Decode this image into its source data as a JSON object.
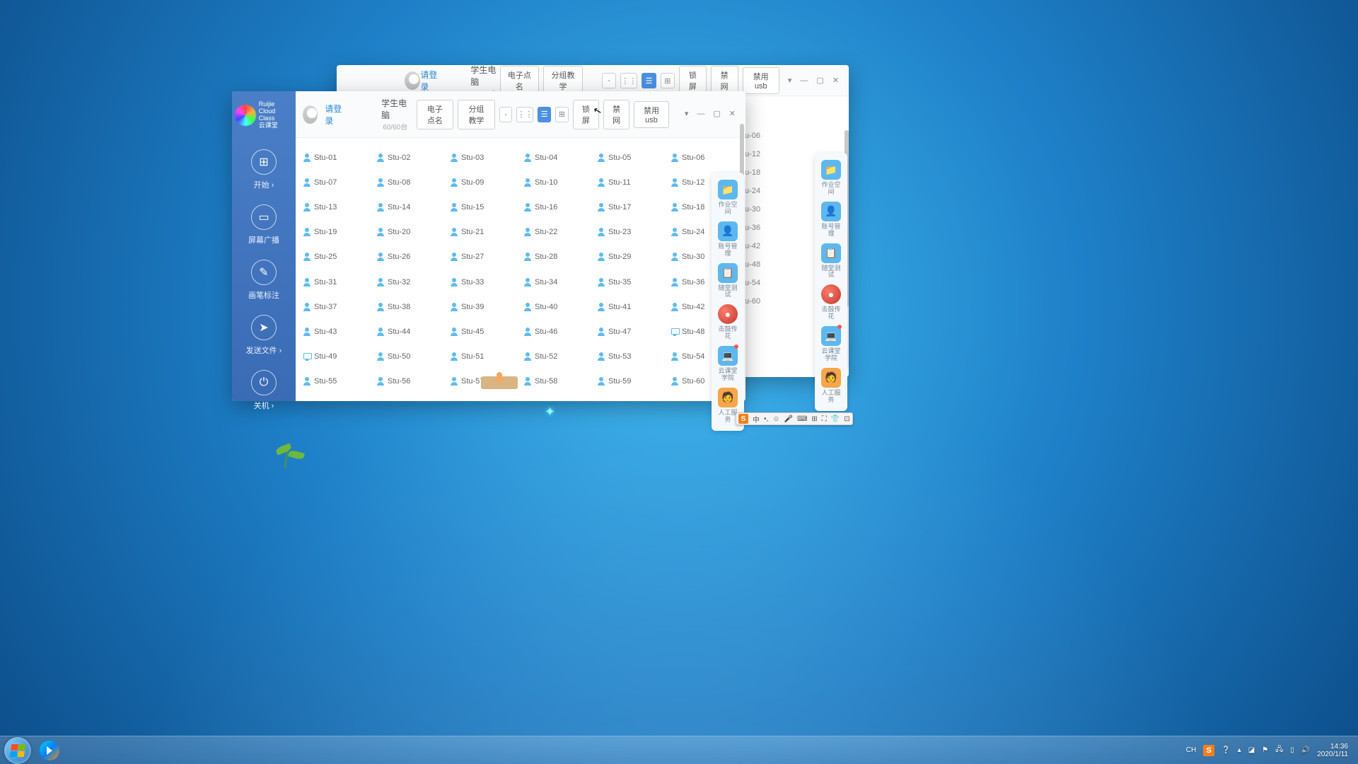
{
  "app": {
    "brand_top": "Ruijie",
    "brand_mid": "Cloud Class",
    "brand_cn": "云课堂"
  },
  "login_text": "请登录",
  "header": {
    "title": "学生电脑",
    "count": "60/60台"
  },
  "toolbar": {
    "roll_call": "电子点名",
    "group_teach": "分组教学",
    "lock_screen": "锁屏",
    "block_net": "禁网",
    "block_usb": "禁用usb",
    "minus": "-"
  },
  "sidebar": {
    "start": "开始 ›",
    "broadcast": "屏幕广播",
    "annotate": "画笔标注",
    "send_file": "发送文件 ›",
    "shutdown": "关机 ›"
  },
  "students": [
    {
      "n": "Stu-01",
      "t": "p"
    },
    {
      "n": "Stu-02",
      "t": "p"
    },
    {
      "n": "Stu-03",
      "t": "p"
    },
    {
      "n": "Stu-04",
      "t": "p"
    },
    {
      "n": "Stu-05",
      "t": "p"
    },
    {
      "n": "Stu-06",
      "t": "p"
    },
    {
      "n": "Stu-07",
      "t": "p"
    },
    {
      "n": "Stu-08",
      "t": "p"
    },
    {
      "n": "Stu-09",
      "t": "p"
    },
    {
      "n": "Stu-10",
      "t": "p"
    },
    {
      "n": "Stu-11",
      "t": "p"
    },
    {
      "n": "Stu-12",
      "t": "p"
    },
    {
      "n": "Stu-13",
      "t": "p"
    },
    {
      "n": "Stu-14",
      "t": "p"
    },
    {
      "n": "Stu-15",
      "t": "p"
    },
    {
      "n": "Stu-16",
      "t": "p"
    },
    {
      "n": "Stu-17",
      "t": "p"
    },
    {
      "n": "Stu-18",
      "t": "p"
    },
    {
      "n": "Stu-19",
      "t": "p"
    },
    {
      "n": "Stu-20",
      "t": "p"
    },
    {
      "n": "Stu-21",
      "t": "p"
    },
    {
      "n": "Stu-22",
      "t": "p"
    },
    {
      "n": "Stu-23",
      "t": "p"
    },
    {
      "n": "Stu-24",
      "t": "p"
    },
    {
      "n": "Stu-25",
      "t": "p"
    },
    {
      "n": "Stu-26",
      "t": "p"
    },
    {
      "n": "Stu-27",
      "t": "p"
    },
    {
      "n": "Stu-28",
      "t": "p"
    },
    {
      "n": "Stu-29",
      "t": "p"
    },
    {
      "n": "Stu-30",
      "t": "p"
    },
    {
      "n": "Stu-31",
      "t": "p"
    },
    {
      "n": "Stu-32",
      "t": "p"
    },
    {
      "n": "Stu-33",
      "t": "p"
    },
    {
      "n": "Stu-34",
      "t": "p"
    },
    {
      "n": "Stu-35",
      "t": "p"
    },
    {
      "n": "Stu-36",
      "t": "p"
    },
    {
      "n": "Stu-37",
      "t": "p"
    },
    {
      "n": "Stu-38",
      "t": "p"
    },
    {
      "n": "Stu-39",
      "t": "p"
    },
    {
      "n": "Stu-40",
      "t": "p"
    },
    {
      "n": "Stu-41",
      "t": "p"
    },
    {
      "n": "Stu-42",
      "t": "p"
    },
    {
      "n": "Stu-43",
      "t": "p"
    },
    {
      "n": "Stu-44",
      "t": "p"
    },
    {
      "n": "Stu-45",
      "t": "p"
    },
    {
      "n": "Stu-46",
      "t": "p"
    },
    {
      "n": "Stu-47",
      "t": "p"
    },
    {
      "n": "Stu-48",
      "t": "m"
    },
    {
      "n": "Stu-49",
      "t": "m"
    },
    {
      "n": "Stu-50",
      "t": "p"
    },
    {
      "n": "Stu-51",
      "t": "p"
    },
    {
      "n": "Stu-52",
      "t": "p"
    },
    {
      "n": "Stu-53",
      "t": "p"
    },
    {
      "n": "Stu-54",
      "t": "p"
    },
    {
      "n": "Stu-55",
      "t": "p"
    },
    {
      "n": "Stu-56",
      "t": "p"
    },
    {
      "n": "Stu-57",
      "t": "p"
    },
    {
      "n": "Stu-58",
      "t": "p"
    },
    {
      "n": "Stu-59",
      "t": "p"
    },
    {
      "n": "Stu-60",
      "t": "p"
    }
  ],
  "back_col": [
    "tu-06",
    "tu-12",
    "tu-18",
    "tu-24",
    "tu-30",
    "tu-36",
    "tu-42",
    "tu-48",
    "tu-54",
    "tu-60"
  ],
  "right_panel": {
    "homework": "作业空间",
    "account": "账号管理",
    "quiz": "随堂测试",
    "drum": "击鼓传花",
    "academy": "云课堂学院",
    "support": "人工服务"
  },
  "colors": {
    "homework": "#5db8f0",
    "account": "#5db8f0",
    "quiz": "#5db8f0",
    "drum": "#e84c3d",
    "academy": "#5db8f0",
    "support": "#f7a64a"
  },
  "ime": {
    "s": "S",
    "lang": "中",
    "items": [
      "•,",
      "☺",
      "⌨",
      "⊞",
      "⛶",
      "👕",
      "⊡"
    ]
  },
  "tray": {
    "ch": "CH",
    "s": "S",
    "time": "14:36",
    "date": "2020/1/11"
  }
}
